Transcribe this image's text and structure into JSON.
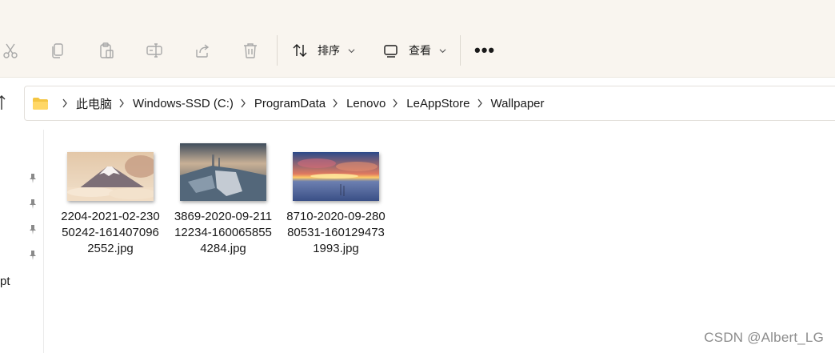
{
  "toolbar": {
    "sort_label": "排序",
    "view_label": "查看",
    "more_label": "•••",
    "icons": [
      "cut-icon",
      "copy-icon",
      "paste-icon",
      "rename-icon",
      "share-icon",
      "delete-icon",
      "sort-icon",
      "view-icon",
      "more-icon"
    ]
  },
  "address": {
    "crumbs": [
      "此电脑",
      "Windows-SSD (C:)",
      "ProgramData",
      "Lenovo",
      "LeAppStore",
      "Wallpaper"
    ]
  },
  "nav": {
    "partial_item": "pt"
  },
  "files": [
    {
      "name": "2204-2021-02-23050242-1614070962552.jpg"
    },
    {
      "name": "3869-2020-09-21112234-1600658554284.jpg"
    },
    {
      "name": "8710-2020-09-28080531-1601294731993.jpg"
    }
  ],
  "watermark": "CSDN @Albert_LG",
  "colors": {
    "toolbar_bg": "#f9f5ef",
    "folder_yellow": "#f4c542",
    "icon_gray": "#9a9a9a"
  }
}
